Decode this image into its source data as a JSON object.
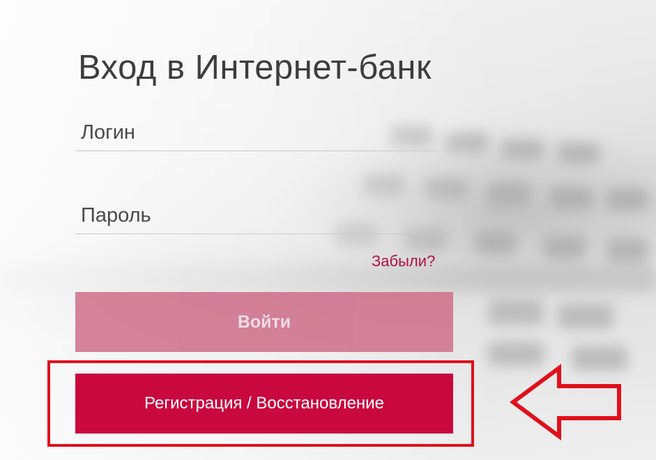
{
  "page": {
    "title": "Вход в Интернет-банк"
  },
  "login_form": {
    "login_placeholder": "Логин",
    "password_placeholder": "Пароль",
    "forgot_label": "Забыли?",
    "login_button_label": "Войти",
    "register_button_label": "Регистрация / Восстановление"
  },
  "colors": {
    "accent": "#c8083e",
    "accent_disabled": "#cf6d8b",
    "annotation": "#e0101a"
  },
  "annotation": {
    "icon": "arrow-left-outline-icon"
  }
}
